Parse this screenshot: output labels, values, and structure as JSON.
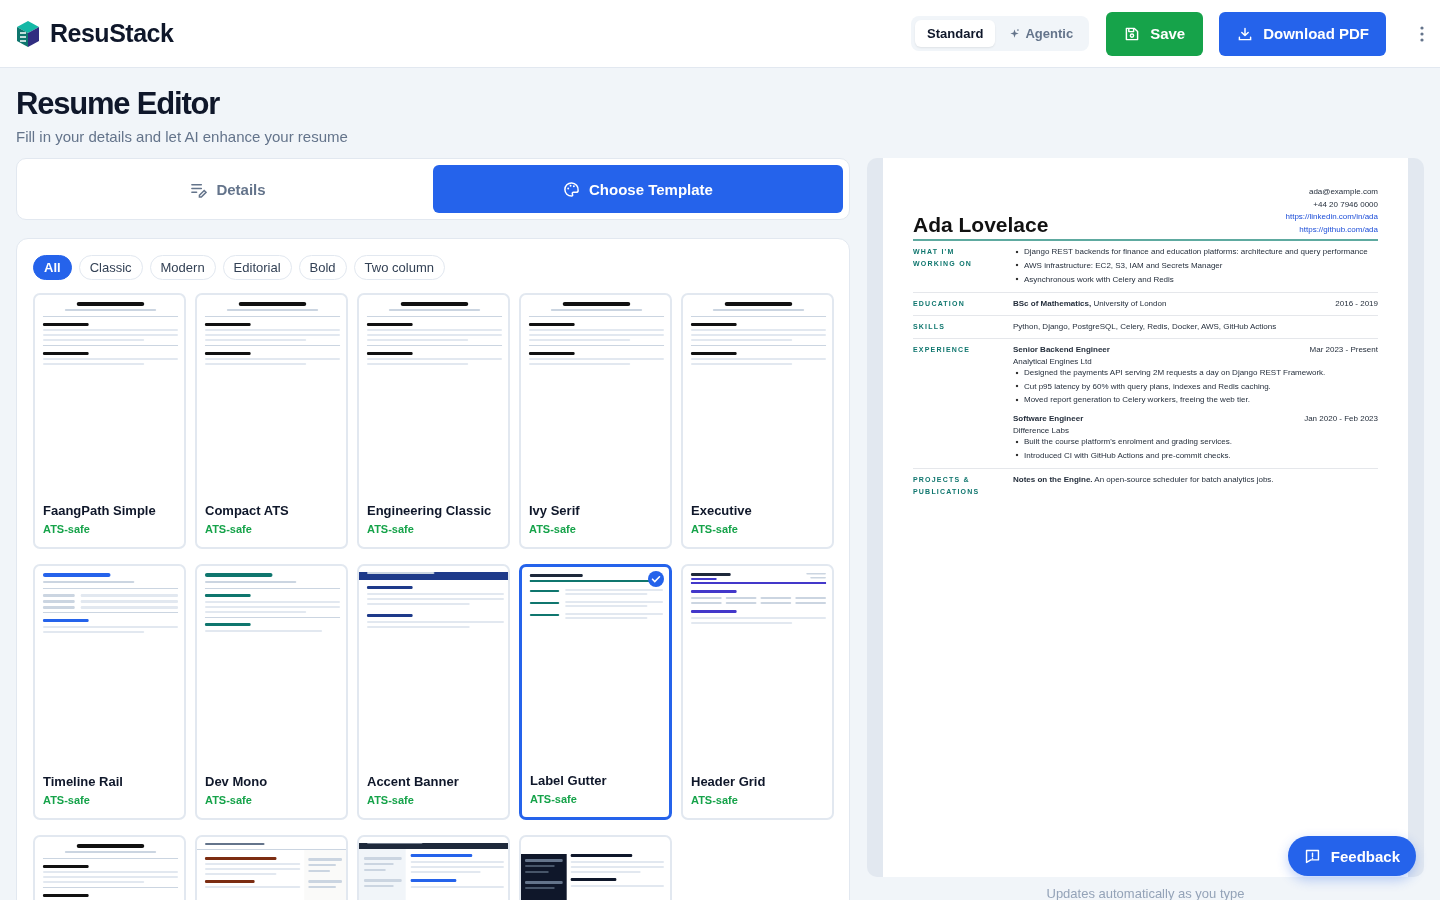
{
  "header": {
    "brand": "ResuStack",
    "modes": [
      {
        "kind": "standard",
        "label": "Standard",
        "selected": true
      },
      {
        "kind": "agentic",
        "label": "Agentic",
        "selected": false
      }
    ],
    "buttons": [
      {
        "kind": "save",
        "label": "Save"
      },
      {
        "kind": "download",
        "label": "Download PDF"
      }
    ]
  },
  "page": {
    "title": "Resume Editor",
    "subtitle": "Fill in your details and let AI enhance your resume"
  },
  "editor_tabs": [
    {
      "kind": "details",
      "label": "Details",
      "selected": false
    },
    {
      "kind": "template",
      "label": "Choose Template",
      "selected": true
    }
  ],
  "filters": [
    {
      "label": "All",
      "selected": true
    },
    {
      "label": "Classic",
      "selected": false
    },
    {
      "label": "Modern",
      "selected": false
    },
    {
      "label": "Editorial",
      "selected": false
    },
    {
      "label": "Bold",
      "selected": false
    },
    {
      "label": "Two column",
      "selected": false
    }
  ],
  "templates": [
    {
      "name": "FaangPath Simple",
      "badge": "ATS-safe",
      "kind": "centered",
      "color": "#111111",
      "selected": false
    },
    {
      "name": "Compact ATS",
      "badge": "ATS-safe",
      "kind": "centered",
      "color": "#111111",
      "selected": false
    },
    {
      "name": "Engineering Classic",
      "badge": "ATS-safe",
      "kind": "centered",
      "color": "#111111",
      "selected": false
    },
    {
      "name": "Ivy Serif",
      "badge": "ATS-safe",
      "kind": "centered",
      "color": "#111111",
      "selected": false
    },
    {
      "name": "Executive",
      "badge": "ATS-safe",
      "kind": "centered",
      "color": "#111111",
      "selected": false
    },
    {
      "name": "Timeline Rail",
      "badge": "ATS-safe",
      "kind": "rail",
      "color": "#2563eb",
      "selected": false
    },
    {
      "name": "Dev Mono",
      "badge": "ATS-safe",
      "kind": "mono",
      "color": "#0f766e",
      "selected": false
    },
    {
      "name": "Accent Banner",
      "badge": "ATS-safe",
      "kind": "banner",
      "color": "#1e3a8a",
      "selected": false
    },
    {
      "name": "Label Gutter",
      "badge": "ATS-safe",
      "kind": "gutter",
      "color": "#0f766e",
      "selected": true
    },
    {
      "name": "Header Grid",
      "badge": "ATS-safe",
      "kind": "grid",
      "color": "#4338ca",
      "selected": false
    },
    {
      "kind": "centered",
      "color": "#111111",
      "selected": false
    },
    {
      "kind": "sidebar-right",
      "color": "#7c2d12",
      "selected": false
    },
    {
      "kind": "sidebar-left",
      "color": "#2563eb",
      "selected": false
    },
    {
      "kind": "sidebar-dark",
      "color": "#0f172a",
      "selected": false
    }
  ],
  "preview": {
    "name": "Ada Lovelace",
    "contact": [
      {
        "text": "ada@example.com",
        "link": false
      },
      {
        "text": "+44 20 7946 0000",
        "link": false
      },
      {
        "text": "https://linkedin.com/in/ada",
        "link": true
      },
      {
        "text": "https://github.com/ada",
        "link": true
      }
    ],
    "sections": [
      {
        "kind": "bullets",
        "label": "WHAT I'M WORKING ON",
        "bullets": [
          "Django REST backends for finance and education platforms: architecture and query performance",
          "AWS infrastructure: EC2, S3, IAM and Secrets Manager",
          "Asynchronous work with Celery and Redis"
        ]
      },
      {
        "kind": "dated",
        "label": "EDUCATION",
        "text": "**BSc of Mathematics,** University of London",
        "date": "2016 - 2019"
      },
      {
        "kind": "text",
        "label": "SKILLS",
        "text": "Python, Django, PostgreSQL, Celery, Redis, Docker, AWS, GitHub Actions"
      },
      {
        "kind": "jobs",
        "label": "EXPERIENCE",
        "jobs": [
          {
            "title": "Senior Backend Engineer",
            "dates": "Mar 2023 - Present",
            "company": "Analytical Engines Ltd",
            "bullets": [
              "Designed the payments API serving 2M requests a day on Django REST Framework.",
              "Cut p95 latency by 60% with query plans, indexes and Redis caching.",
              "Moved report generation to Celery workers, freeing the web tier."
            ]
          },
          {
            "title": "Software Engineer",
            "dates": "Jan 2020 - Feb 2023",
            "company": "Difference Labs",
            "bullets": [
              "Built the course platform's enrolment and grading services.",
              "Introduced CI with GitHub Actions and pre-commit checks."
            ]
          }
        ]
      },
      {
        "kind": "text",
        "label": "PROJECTS & PUBLICATIONS",
        "text": "**Notes on the Engine.** An open-source scheduler for batch analytics jobs."
      }
    ],
    "caption": "Updates automatically as you type"
  },
  "feedback": {
    "label": "Feedback"
  }
}
